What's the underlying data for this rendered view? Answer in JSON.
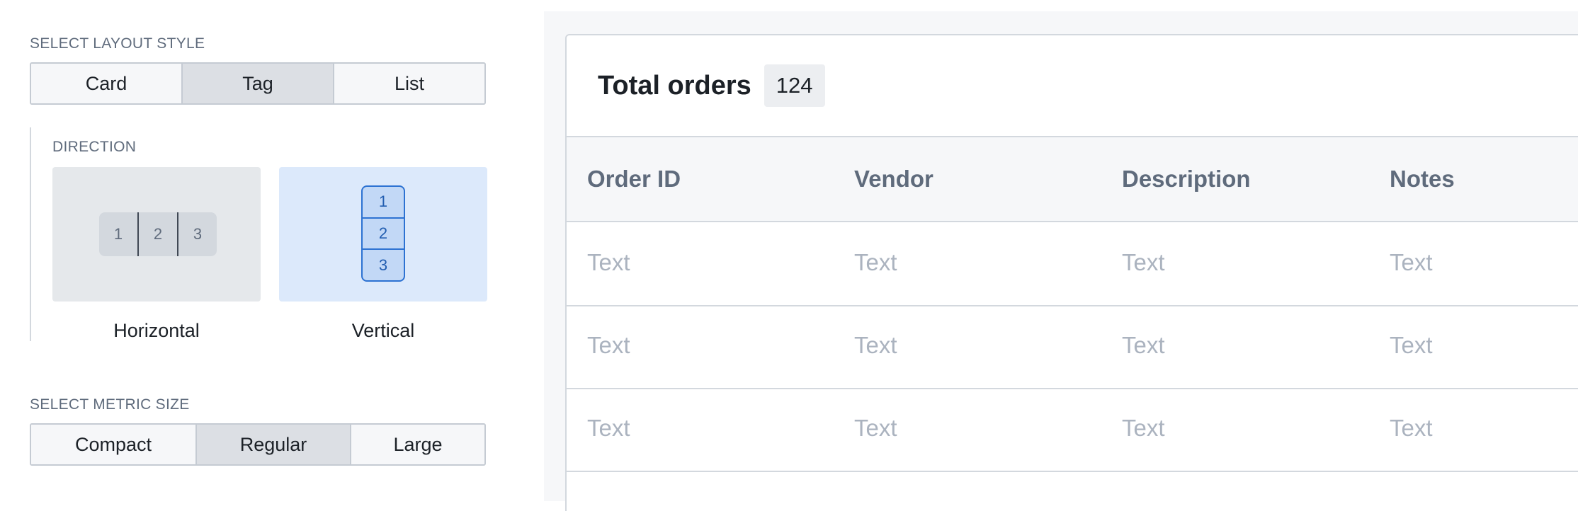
{
  "layout_style": {
    "label": "SELECT LAYOUT STYLE",
    "options": [
      "Card",
      "Tag",
      "List"
    ],
    "selected": "Tag"
  },
  "direction": {
    "label": "DIRECTION",
    "horizontal": {
      "caption": "Horizontal",
      "items": [
        "1",
        "2",
        "3"
      ]
    },
    "vertical": {
      "caption": "Vertical",
      "items": [
        "1",
        "2",
        "3"
      ]
    },
    "selected": "Vertical"
  },
  "metric_size": {
    "label": "SELECT METRIC SIZE",
    "options": [
      "Compact",
      "Regular",
      "Large"
    ],
    "selected": "Regular"
  },
  "table": {
    "title": "Total orders",
    "count": "124",
    "columns": [
      "Order ID",
      "Vendor",
      "Description",
      "Notes"
    ],
    "rows": [
      [
        "Text",
        "Text",
        "Text",
        "Text"
      ],
      [
        "Text",
        "Text",
        "Text",
        "Text"
      ],
      [
        "Text",
        "Text",
        "Text",
        "Text"
      ]
    ]
  },
  "colors": {
    "active_segment": "#dcdfe4",
    "selected_card": "#dce9fb",
    "selected_accent": "#2d72d2"
  }
}
